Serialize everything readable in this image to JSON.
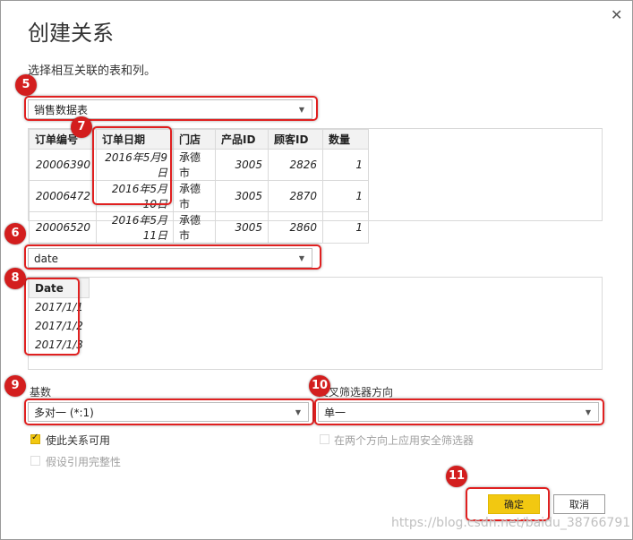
{
  "dialog": {
    "title": "创建关系",
    "close_glyph": "✕",
    "subtitle": "选择相互关联的表和列。"
  },
  "table1": {
    "selected": "销售数据表",
    "columns": [
      "订单编号",
      "订单日期",
      "门店",
      "产品ID",
      "顾客ID",
      "数量"
    ],
    "rows": [
      [
        "20006390",
        "2016年5月9日",
        "承德市",
        "3005",
        "2826",
        "1"
      ],
      [
        "20006472",
        "2016年5月10日",
        "承德市",
        "3005",
        "2870",
        "1"
      ],
      [
        "20006520",
        "2016年5月11日",
        "承德市",
        "3005",
        "2860",
        "1"
      ]
    ]
  },
  "table2": {
    "selected": "date",
    "columns": [
      "Date"
    ],
    "rows": [
      [
        "2017/1/1"
      ],
      [
        "2017/1/2"
      ],
      [
        "2017/1/3"
      ]
    ]
  },
  "cardinality": {
    "label": "基数",
    "selected": "多对一 (*:1)"
  },
  "filter_direction": {
    "label": "交叉筛选器方向",
    "selected": "单一"
  },
  "options": {
    "active_label": "使此关系可用",
    "active_checked": true,
    "security_label": "在两个方向上应用安全筛选器",
    "integrity_label": "假设引用完整性"
  },
  "buttons": {
    "ok": "确定",
    "cancel": "取消"
  },
  "markers": [
    "5",
    "6",
    "7",
    "8",
    "9",
    "10",
    "11"
  ],
  "watermark": "https://blog.csdn.net/baidu_38766791",
  "colors": {
    "accent": "#f2c811",
    "highlight": "#e02020",
    "marker": "#d31e1e"
  }
}
